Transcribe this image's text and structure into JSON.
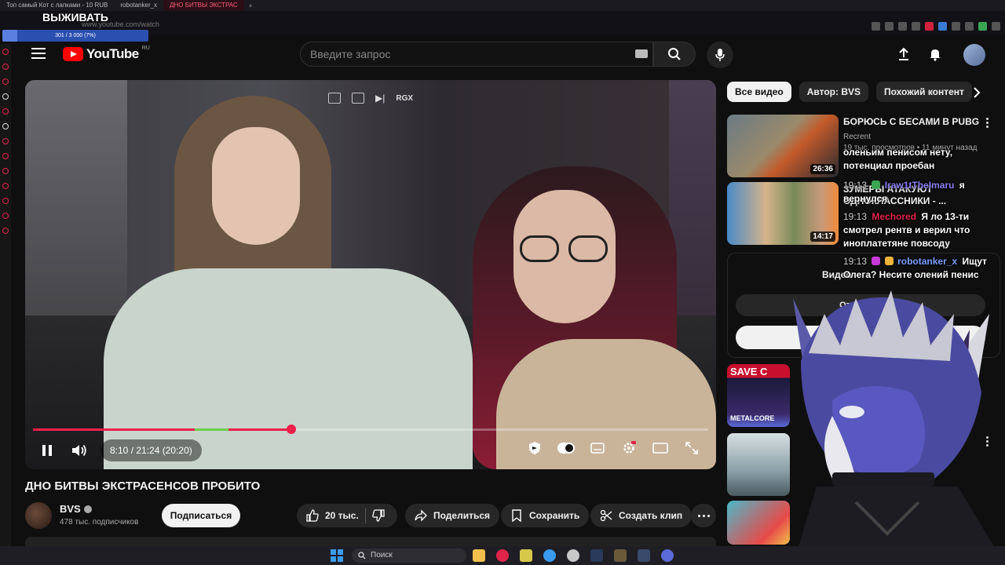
{
  "browser": {
    "tabs": [
      {
        "label": "Топ самый Кот с лапками - 10 RUB",
        "active": false
      },
      {
        "label": "robotanker_x",
        "active": false
      },
      {
        "label": "ДНО БИТВЫ ЭКСТРАС",
        "active": true
      }
    ],
    "url": "www.youtube.com/watch"
  },
  "stream_overlay": {
    "title": "ВЫЖИВАТЬ",
    "progress_text": "301 / 3 000 (7%)",
    "progress_fraction": 0.1
  },
  "header": {
    "logo_text": "YouTube",
    "logo_sup": "RU",
    "search_placeholder": "Введите запрос"
  },
  "player": {
    "overlay_label": "RGX",
    "time_text": "8:10 / 21:24 (20:20)",
    "progress_fraction": 0.382,
    "green_segment": [
      0.24,
      0.29
    ],
    "colors": {
      "progress": "#f01f4a",
      "segment": "#6bd04a"
    }
  },
  "video": {
    "title": "ДНО БИТВЫ ЭКСТРАСЕНСОВ ПРОБИТО",
    "channel": "BVS",
    "subscribers": "478 тыс. подписчиков",
    "subscribe_label": "Подписаться",
    "likes_label": "20 тыс.",
    "share_label": "Поделиться",
    "save_label": "Сохранить",
    "clip_label": "Создать клип"
  },
  "sidebar": {
    "chips": [
      "Все видео",
      "Автор: BVS",
      "Похожий контент"
    ],
    "recommendations": [
      {
        "title": "БОРЮСЬ С БЕСАМИ В PUBG",
        "channel": "Recrent",
        "meta": "19 тыс. просмотров • 11 минут назад",
        "duration": "26:36"
      },
      {
        "title": "ЗУМЕРЫ АТАКУЮТ ОДНОКЛАССНИКИ - ...",
        "channel": "",
        "meta": "",
        "duration": "14:17"
      }
    ],
    "notif_text": "Видео",
    "notif_cancel": "Отменить",
    "save_thumb_text": "SAVE C",
    "metalcore_text": "METALCORE"
  },
  "chat": [
    {
      "time": "",
      "user": "",
      "text": "оленьим пенисом нету, потенциал проебан",
      "user_color": "#fff"
    },
    {
      "time": "19:13",
      "user": "Iraw1tTheImaru",
      "text": "я вернулся",
      "user_color": "#8a7cf0"
    },
    {
      "time": "19:13",
      "user": "Mechored",
      "text": "Я ло 13-ти смотрел рентв и верил что иноплатетяне повсоду",
      "user_color": "#e0244a"
    },
    {
      "time": "19:13",
      "user": "robotanker_x",
      "text": "Ищут Олега? Несите олений пенис",
      "user_color": "#7aa0ff"
    }
  ],
  "taskbar": {
    "search_label": "Поиск"
  }
}
